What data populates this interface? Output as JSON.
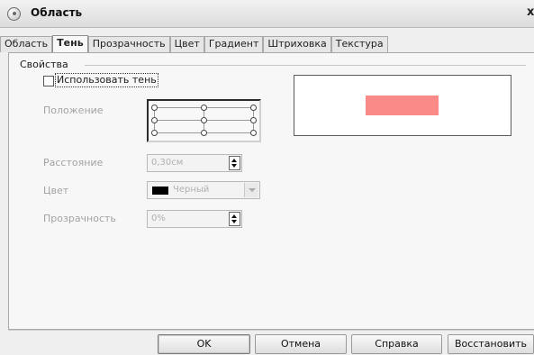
{
  "window": {
    "title": "Область",
    "close_glyph": "x",
    "app_icon": "app-icon"
  },
  "tabs": [
    {
      "label": "Область",
      "active": false
    },
    {
      "label": "Тень",
      "active": true
    },
    {
      "label": "Прозрачность",
      "active": false
    },
    {
      "label": "Цвет",
      "active": false
    },
    {
      "label": "Градиент",
      "active": false
    },
    {
      "label": "Штриховка",
      "active": false
    },
    {
      "label": "Текстура",
      "active": false
    }
  ],
  "properties": {
    "group_label": "Свойства",
    "use_shadow_label": "Использовать тень",
    "use_shadow_checked": false,
    "position_label": "Положение",
    "distance_label": "Расстояние",
    "distance_value": "0,30см",
    "color_label": "Цвет",
    "color_value": "Черный",
    "color_swatch": "#000000",
    "transparency_label": "Прозрачность",
    "transparency_value": "0%"
  },
  "preview": {
    "shape_color": "#f98a87"
  },
  "buttons": {
    "ok": "OK",
    "cancel": "Отмена",
    "help": "Справка",
    "reset": "Восстановить"
  }
}
